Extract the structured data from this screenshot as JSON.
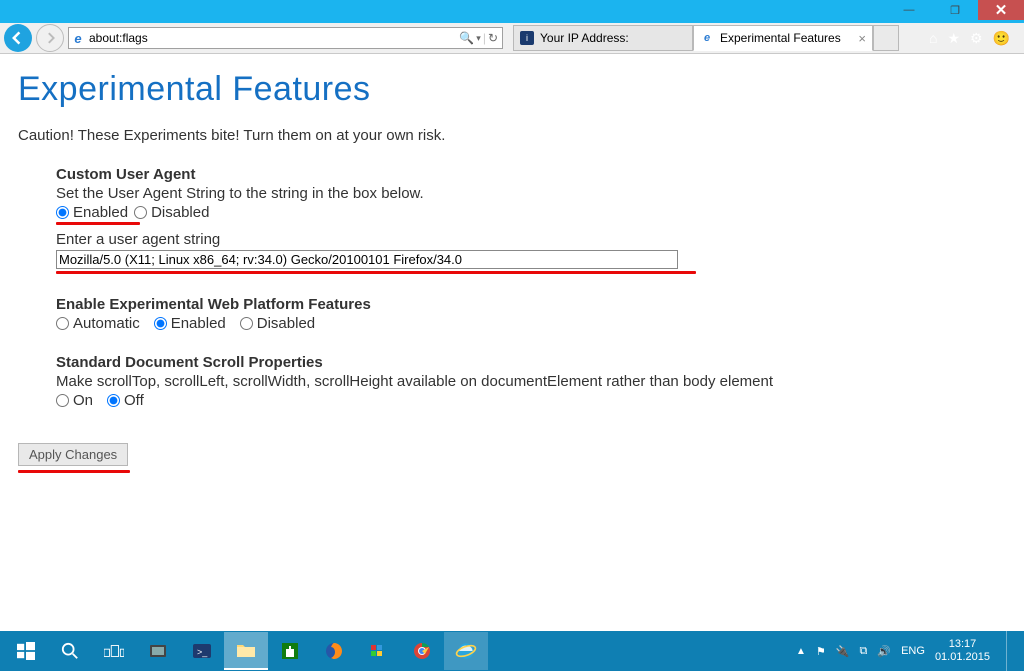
{
  "window": {
    "minimize": "—",
    "maximize": "❐",
    "close": "✕"
  },
  "toolbar": {
    "address": "about:flags",
    "search_hint": "🔍",
    "refresh_hint": "↻",
    "tabs": [
      {
        "title": "Your IP Address:",
        "active": false
      },
      {
        "title": "Experimental Features",
        "active": true
      }
    ]
  },
  "page": {
    "title": "Experimental Features",
    "caution": "Caution! These Experiments bite! Turn them on at your own risk.",
    "ua": {
      "heading": "Custom User Agent",
      "desc": "Set the User Agent String to the string in the box below.",
      "enabled_label": "Enabled",
      "disabled_label": "Disabled",
      "input_label": "Enter a user agent string",
      "value": "Mozilla/5.0 (X11; Linux x86_64; rv:34.0) Gecko/20100101 Firefox/34.0"
    },
    "webplat": {
      "heading": "Enable Experimental Web Platform Features",
      "automatic": "Automatic",
      "enabled": "Enabled",
      "disabled": "Disabled"
    },
    "scroll": {
      "heading": "Standard Document Scroll Properties",
      "desc": "Make scrollTop, scrollLeft, scrollWidth, scrollHeight available on documentElement rather than body element",
      "on": "On",
      "off": "Off"
    },
    "apply": "Apply Changes"
  },
  "taskbar": {
    "tray": {
      "lang": "ENG",
      "time": "13:17",
      "date": "01.01.2015"
    }
  }
}
